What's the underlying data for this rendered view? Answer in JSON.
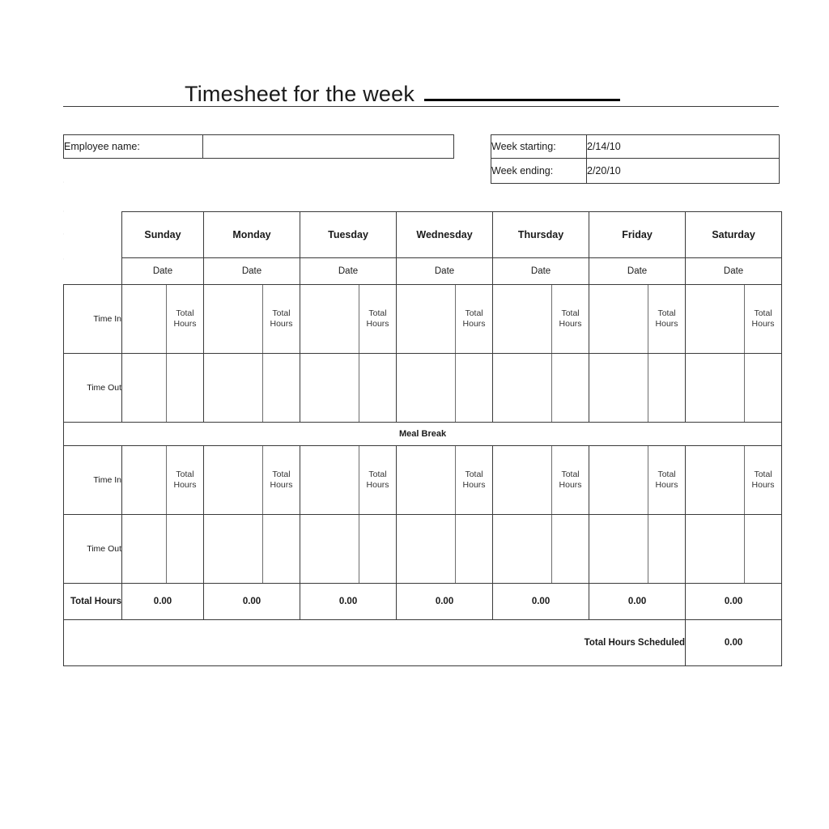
{
  "document": {
    "title_text": "Timesheet for the week",
    "title_blank": ""
  },
  "info": {
    "employee_label": "Employee name:",
    "employee_value": "",
    "week_starting_label": "Week starting:",
    "week_starting_value": "2/14/10",
    "week_ending_label": "Week ending:",
    "week_ending_value": "2/20/10"
  },
  "table": {
    "days": [
      "Sunday",
      "Monday",
      "Tuesday",
      "Wednesday",
      "Thursday",
      "Friday",
      "Saturday"
    ],
    "date_label": "Date",
    "total_hours_sub_label": "Total Hours",
    "rows": {
      "time_in_label": "Time In",
      "time_out_label": "Time Out",
      "meal_break_label": "Meal Break",
      "total_hours_label": "Total Hours"
    },
    "daily_totals": [
      "0.00",
      "0.00",
      "0.00",
      "0.00",
      "0.00",
      "0.00",
      "0.00"
    ],
    "scheduled_label": "Total Hours Scheduled",
    "scheduled_value": "0.00"
  },
  "colors": {
    "header_green": "#e7eed5",
    "date_cream": "#fdfaf0",
    "total_gray": "#e6e6e6",
    "border_dark": "#3a3a3a",
    "grid_faint": "#e3e3e3"
  }
}
